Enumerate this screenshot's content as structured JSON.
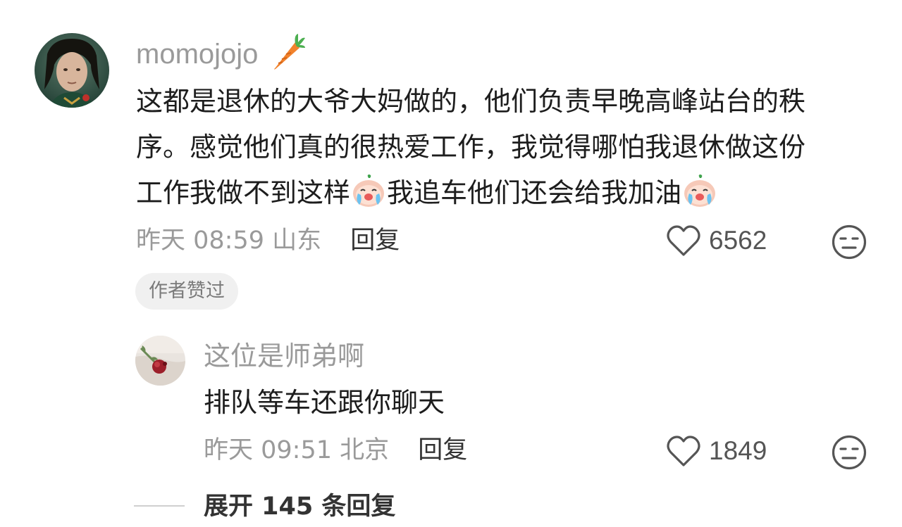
{
  "comment": {
    "username": "momojojo",
    "username_emoji": "carrot",
    "text_lines": [
      "这都是退休的大爷大妈做的，他们负责早晚高峰站台的秩",
      "序。感觉他们真的很热爱工作，我觉得哪怕我退休做这份",
      "工作我做不到这样",
      "我追车他们还会给我加油"
    ],
    "inline_emoji": "crying-face",
    "time": "昨天 08:59",
    "location": "山东",
    "reply_label": "回复",
    "likes": "6562",
    "badge": "作者赞过"
  },
  "reply": {
    "username": "这位是师弟啊",
    "text": "排队等车还跟你聊天",
    "time": "昨天 09:51",
    "location": "北京",
    "reply_label": "回复",
    "likes": "1849"
  },
  "expand": {
    "label": "展开 145 条回复"
  },
  "icons": {
    "like": "heart-outline-icon",
    "dislike": "meh-face-icon"
  },
  "colors": {
    "text": "#1d1d1d",
    "muted": "#9a9a9a",
    "badge_bg": "#f0f0f0",
    "carrot": "#f2822c"
  }
}
